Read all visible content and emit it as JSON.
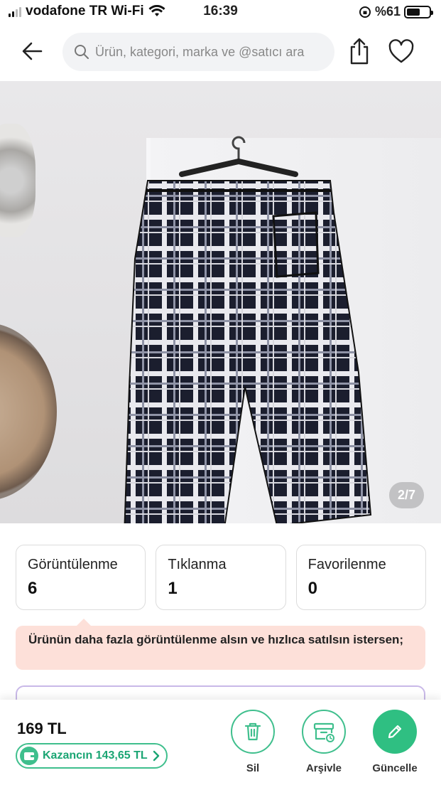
{
  "status": {
    "carrier": "vodafone TR Wi-Fi",
    "time": "16:39",
    "battery": "%61",
    "battery_level": 0.61
  },
  "nav": {
    "search_placeholder": "Ürün, kategori, marka ve @satıcı ara"
  },
  "gallery": {
    "indicator": "2/7"
  },
  "stats": [
    {
      "label": "Görüntülenme",
      "value": "6"
    },
    {
      "label": "Tıklanma",
      "value": "1"
    },
    {
      "label": "Favorilenme",
      "value": "0"
    }
  ],
  "promo": {
    "text": "Ürünün daha fazla görüntülenme alsın ve hızlıca satılsın istersen;"
  },
  "bottom": {
    "price": "169 TL",
    "earnings": "Kazancın 143,65 TL",
    "actions": {
      "delete": "Sil",
      "archive": "Arşivle",
      "update": "Güncelle"
    }
  },
  "colors": {
    "accent": "#2fbf82",
    "promo_bg": "#fde0d9"
  }
}
